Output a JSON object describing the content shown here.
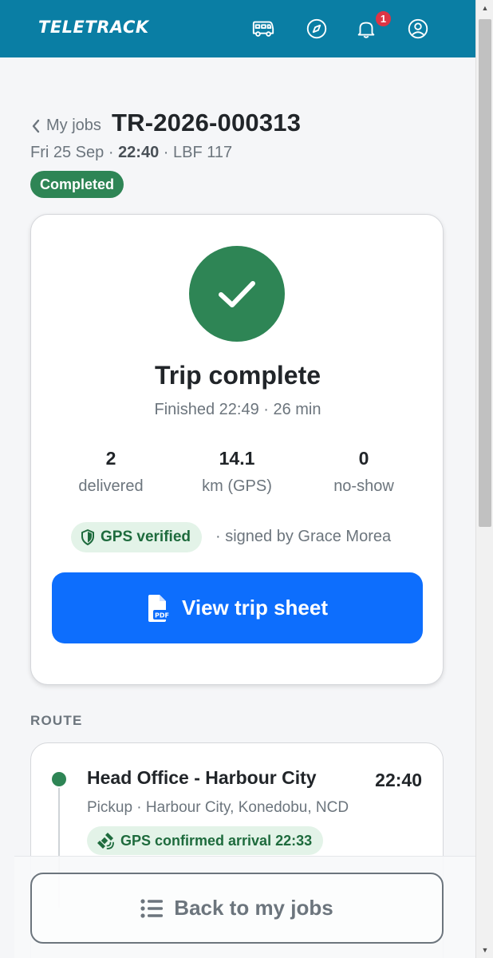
{
  "header": {
    "logo": "TELETRACK",
    "notification_count": "1",
    "icons": [
      "bus-icon",
      "compass-icon",
      "bell-icon",
      "user-icon"
    ],
    "bar_color": "#0a7ea4"
  },
  "job": {
    "back_label": "My jobs",
    "id": "TR-2026-000313",
    "date": "Fri 25 Sep",
    "time": "22:40",
    "vehicle": "LBF 117",
    "separator": "·",
    "status": "Completed",
    "status_color": "#2e8555"
  },
  "summary": {
    "title": "Trip complete",
    "finished": "Finished 22:49 · 26 min",
    "stats": [
      {
        "value": "2",
        "label": "delivered"
      },
      {
        "value": "14.1",
        "label": "km (GPS)"
      },
      {
        "value": "0",
        "label": "no-show"
      }
    ],
    "gps_label": "GPS verified",
    "signed_text": "· signed by Grace Morea",
    "primary_button": "View trip sheet",
    "pdf_label": "PDF",
    "primary_color": "#0d6efd"
  },
  "route": {
    "section_label": "ROUTE",
    "stops": [
      {
        "name": "Head Office - Harbour City",
        "time": "22:40",
        "address": "Pickup · Harbour City, Konedobu, NCD",
        "arrival": "GPS confirmed arrival 22:33"
      }
    ]
  },
  "footer": {
    "back_button": "Back to my jobs"
  }
}
